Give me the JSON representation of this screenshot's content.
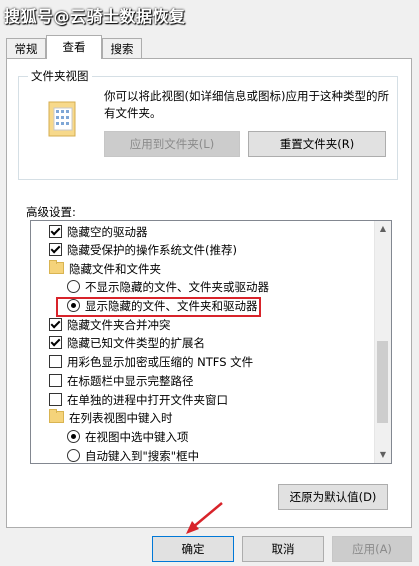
{
  "watermark": "搜狐号@云骑士数据恢复",
  "tabs": [
    {
      "label": "常规"
    },
    {
      "label": "查看"
    },
    {
      "label": "搜索"
    }
  ],
  "folder_views": {
    "group_label": "文件夹视图",
    "description": "你可以将此视图(如详细信息或图标)应用于这种类型的所有文件夹。",
    "apply_button": "应用到文件夹(L)",
    "reset_button": "重置文件夹(R)"
  },
  "advanced": {
    "label": "高级设置:",
    "items": [
      {
        "type": "checkbox",
        "checked": true,
        "label": "隐藏空的驱动器"
      },
      {
        "type": "checkbox",
        "checked": true,
        "label": "隐藏受保护的操作系统文件(推荐)"
      },
      {
        "type": "folder",
        "label": "隐藏文件和文件夹"
      },
      {
        "type": "radio",
        "checked": false,
        "label": "不显示隐藏的文件、文件夹或驱动器"
      },
      {
        "type": "radio",
        "checked": true,
        "label": "显示隐藏的文件、文件夹和驱动器"
      },
      {
        "type": "checkbox",
        "checked": true,
        "label": "隐藏文件夹合并冲突"
      },
      {
        "type": "checkbox",
        "checked": true,
        "label": "隐藏已知文件类型的扩展名"
      },
      {
        "type": "checkbox",
        "checked": false,
        "label": "用彩色显示加密或压缩的 NTFS 文件"
      },
      {
        "type": "checkbox",
        "checked": false,
        "label": "在标题栏中显示完整路径"
      },
      {
        "type": "checkbox",
        "checked": false,
        "label": "在单独的进程中打开文件夹窗口"
      },
      {
        "type": "folder",
        "label": "在列表视图中键入时"
      },
      {
        "type": "radio",
        "checked": true,
        "label": "在视图中选中键入项"
      },
      {
        "type": "radio",
        "checked": false,
        "label": "自动键入到\"搜索\"框中"
      }
    ],
    "restore_button": "还原为默认值(D)"
  },
  "dialog_buttons": {
    "ok": "确定",
    "cancel": "取消",
    "apply": "应用(A)"
  },
  "colors": {
    "highlight": "#d8232a",
    "focus": "#0078d7"
  }
}
